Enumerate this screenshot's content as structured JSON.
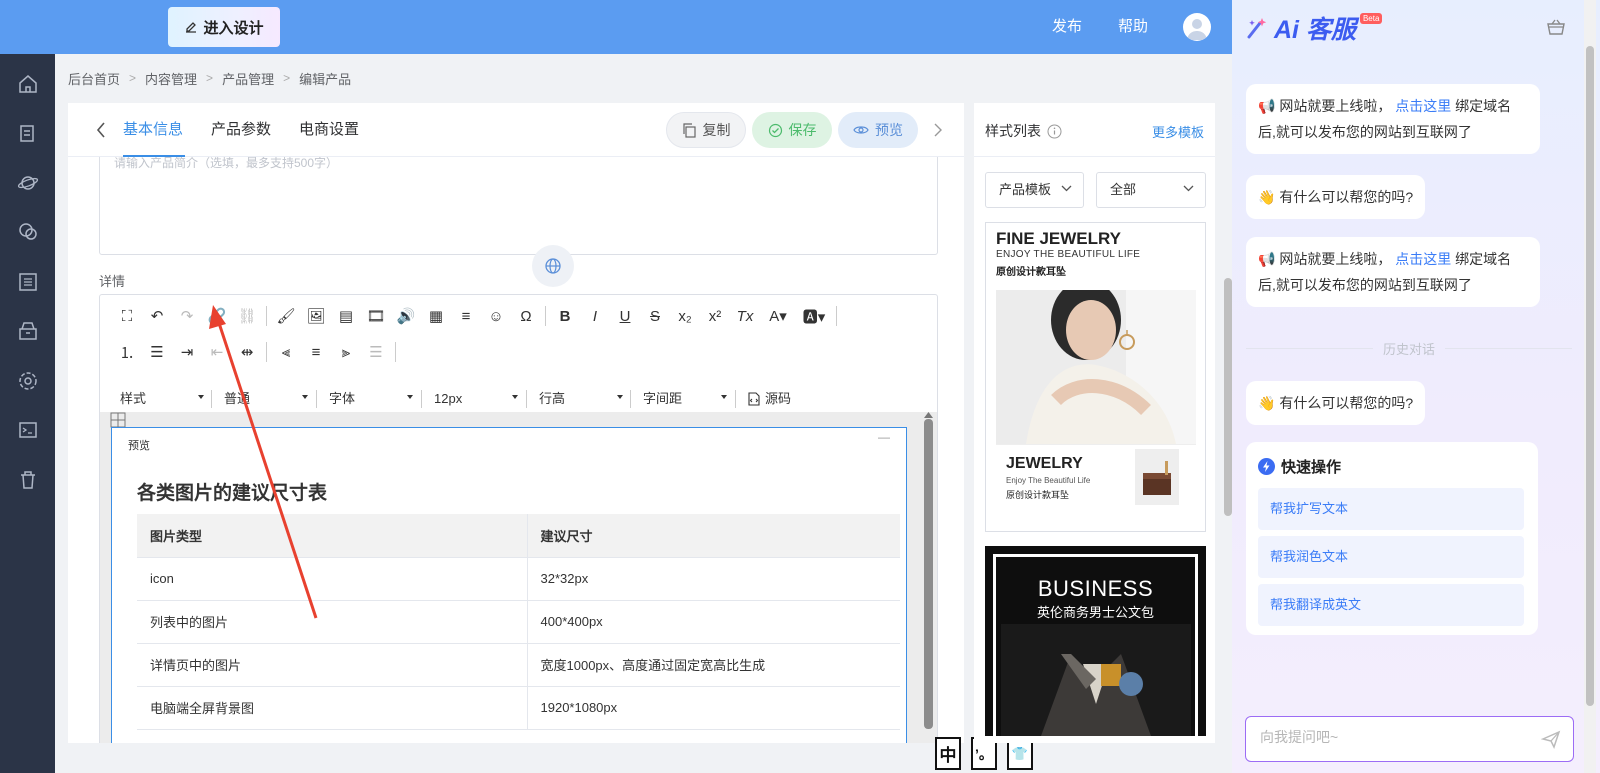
{
  "topbar": {
    "design_button": "进入设计",
    "publish": "发布",
    "help": "帮助"
  },
  "sidebar": {
    "icons": [
      "home-icon",
      "document-icon",
      "planet-icon",
      "chat-icon",
      "list-icon",
      "shop-icon",
      "settings-icon",
      "terminal-icon",
      "trash-icon"
    ]
  },
  "breadcrumb": [
    "后台首页",
    "内容管理",
    "产品管理",
    "编辑产品"
  ],
  "tabs": {
    "basic": "基本信息",
    "params": "产品参数",
    "ecommerce": "电商设置"
  },
  "actions": {
    "copy": "复制",
    "save": "保存",
    "preview": "预览"
  },
  "summary": {
    "placeholder": "请输入产品简介（选填，最多支持500字）"
  },
  "detail": {
    "label": "详情"
  },
  "toolbar": {
    "style": "样式",
    "paragraph": "普通",
    "font": "字体",
    "font_size": "12px",
    "line_height": "行高",
    "letter_spacing": "字间距",
    "source": "源码"
  },
  "doc": {
    "preview_label": "预览",
    "title": "各类图片的建议尺寸表",
    "table": {
      "headers": [
        "图片类型",
        "建议尺寸"
      ],
      "rows": [
        [
          "icon",
          "32*32px"
        ],
        [
          "列表中的图片",
          "400*400px"
        ],
        [
          "详情页中的图片",
          "宽度1000px、高度通过固定宽高比生成"
        ],
        [
          "电脑端全屏背景图",
          "1920*1080px"
        ]
      ]
    }
  },
  "ime": [
    "中",
    "’。",
    "👕"
  ],
  "style_panel": {
    "title": "样式列表",
    "more": "更多模板",
    "select_category": "产品模板",
    "select_filter": "全部",
    "tpl1": {
      "title": "FINE JEWELRY",
      "subtitle": "ENJOY THE BEAUTIFUL LIFE",
      "cn": "原创设计款耳坠",
      "bottom_title": "JEWELRY",
      "bottom_sub": "Enjoy The Beautiful Life",
      "bottom_cn": "原创设计款耳坠"
    },
    "tpl2": {
      "title": "BUSINESS",
      "cn": "英伦商务男士公文包"
    }
  },
  "ai": {
    "brand": "Ai 客服",
    "beta": "Beta",
    "messages": [
      {
        "pre": "网站就要上线啦，",
        "link": "点击这里",
        "post": "绑定域名后,就可以发布您的网站到互联网了"
      },
      {
        "text": "有什么可以帮您的吗?"
      },
      {
        "pre": "网站就要上线啦，",
        "link": "点击这里",
        "post": "绑定域名后,就可以发布您的网站到互联网了"
      }
    ],
    "history": "历史对话",
    "last_message": "有什么可以帮您的吗?",
    "quick_title": "快速操作",
    "quick_items": [
      "帮我扩写文本",
      "帮我润色文本",
      "帮我翻译成英文"
    ],
    "input_placeholder": "向我提问吧~"
  },
  "colors": {
    "topbar": "#5b9cf1",
    "sidebar": "#2b3447",
    "accent": "#3a8ee6",
    "annotation_arrow": "#e8412f"
  }
}
